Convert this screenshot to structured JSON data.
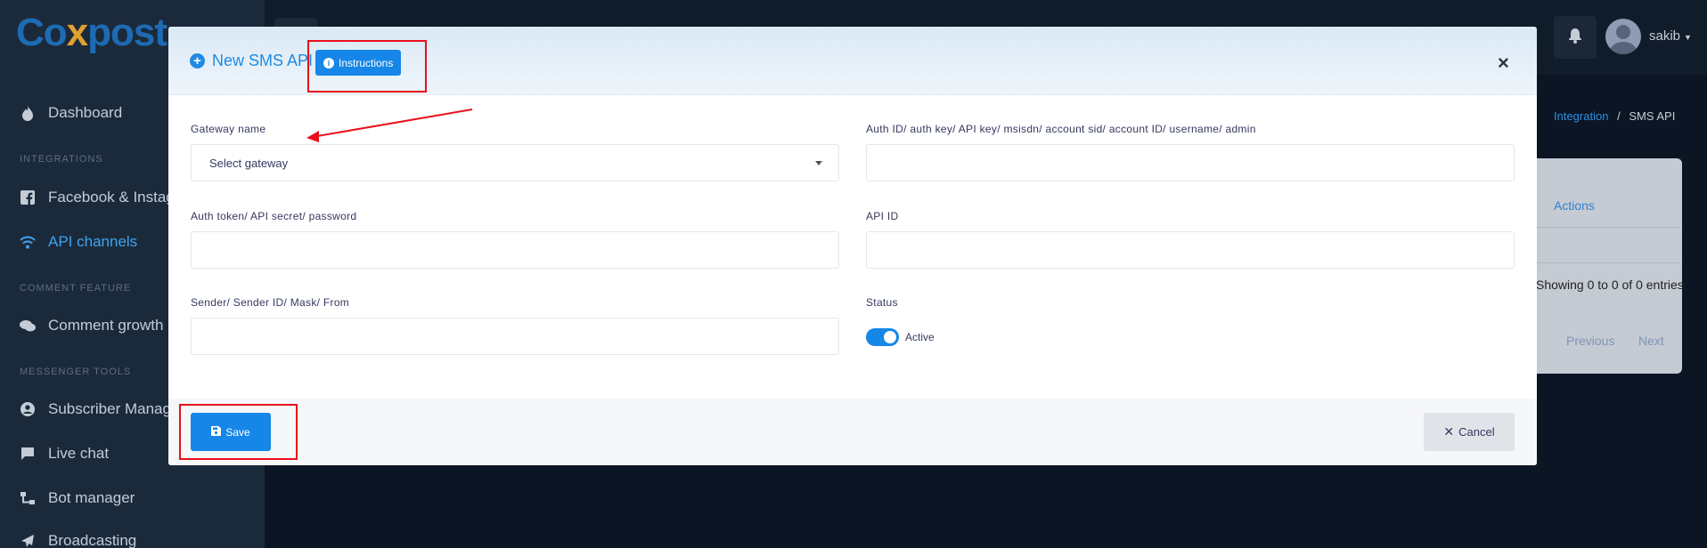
{
  "app": {
    "logo_text": "Coxpost",
    "user_name": "sakib"
  },
  "sidebar": {
    "items": [
      {
        "label": "Dashboard",
        "icon": "fire-icon"
      },
      {
        "section": "INTEGRATIONS"
      },
      {
        "label": "Facebook & Instag",
        "icon": "facebook-icon"
      },
      {
        "label": "API channels",
        "icon": "wifi-icon",
        "active": true
      },
      {
        "section": "COMMENT FEATURE"
      },
      {
        "label": "Comment growth",
        "icon": "comments-icon"
      },
      {
        "section": "MESSENGER TOOLS"
      },
      {
        "label": "Subscriber Manag",
        "icon": "user-circle-icon"
      },
      {
        "label": "Live chat",
        "icon": "chat-icon"
      },
      {
        "label": "Bot manager",
        "icon": "sitemap-icon"
      },
      {
        "label": "Broadcasting",
        "icon": "paper-plane-icon"
      }
    ]
  },
  "breadcrumb": {
    "link": "Integration",
    "separator": "/",
    "current": "SMS API"
  },
  "background_table": {
    "actions_header": "Actions",
    "entries_text": "Showing 0 to 0 of 0 entries",
    "previous": "Previous",
    "next": "Next"
  },
  "modal": {
    "title": "New SMS API",
    "instructions_label": "Instructions",
    "close_symbol": "×",
    "fields": {
      "gateway_name_label": "Gateway name",
      "gateway_name_value": "Select gateway",
      "auth_id_label": "Auth ID/ auth key/ API key/ msisdn/ account sid/ account ID/ username/ admin",
      "auth_id_value": "",
      "auth_token_label": "Auth token/ API secret/ password",
      "auth_token_value": "",
      "api_id_label": "API ID",
      "api_id_value": "",
      "sender_label": "Sender/ Sender ID/ Mask/ From",
      "sender_value": "",
      "status_label": "Status",
      "status_toggle_label": "Active",
      "status_on": true
    },
    "save_label": "Save",
    "cancel_label": "Cancel"
  },
  "colors": {
    "primary": "#1687e8",
    "highlight": "#e8101b",
    "sidebar_bg": "#1b2a3b",
    "page_bg": "#0c1524"
  }
}
